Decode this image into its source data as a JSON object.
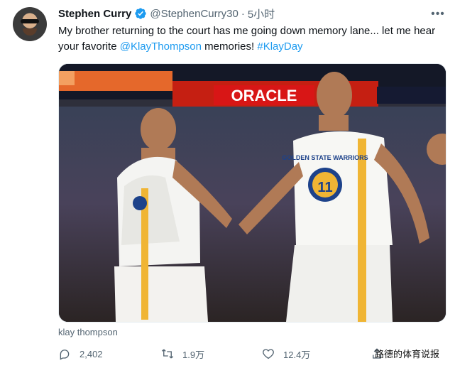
{
  "tweet": {
    "author_name": "Stephen Curry",
    "handle": "@StephenCurry30",
    "separator": "·",
    "time": "5小时",
    "text_part1": "My brother returning to the court has me going down memory lane... let me hear your favorite ",
    "mention": "@KlayThompson",
    "text_part2": " memories! ",
    "hashtag": "#KlayDay",
    "caption": "klay thompson",
    "actions": {
      "reply_count": "2,402",
      "retweet_count": "1.9万",
      "like_count": "12.4万"
    },
    "watermark": "路德的体育说报"
  },
  "colors": {
    "link": "#1d9bf0",
    "muted": "#536471",
    "text": "#0f1419",
    "verified": "#1d9bf0"
  },
  "image": {
    "arena_sign": "ORACLE",
    "jersey_text": "GOLDEN STATE WARRIORS",
    "jersey_number": "11"
  },
  "icons": {
    "verified": "verified-badge-icon",
    "more": "more-options-icon",
    "reply": "reply-icon",
    "retweet": "retweet-icon",
    "like": "heart-icon",
    "share": "share-icon"
  }
}
